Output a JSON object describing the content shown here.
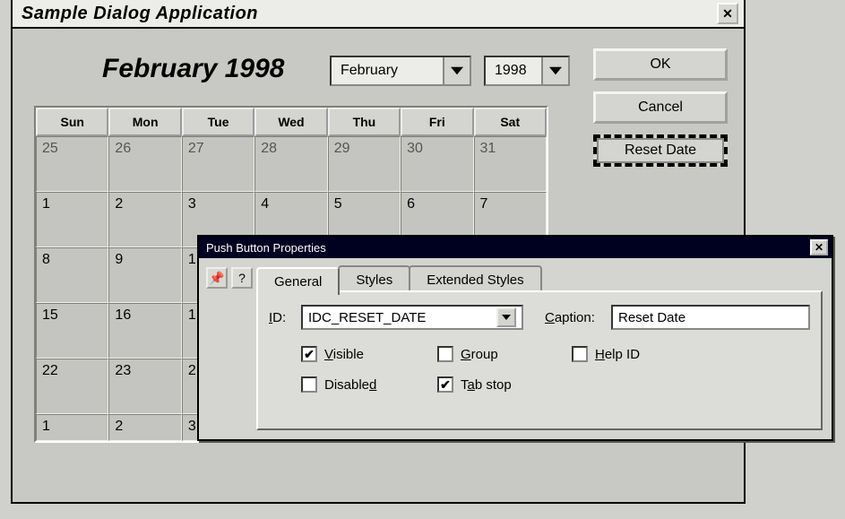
{
  "dialog": {
    "title": "Sample Dialog Application",
    "month_heading": "February 1998",
    "month_select": {
      "value": "February"
    },
    "year_select": {
      "value": "1998"
    },
    "buttons": {
      "ok": "OK",
      "cancel": "Cancel",
      "reset": "Reset Date"
    },
    "calendar": {
      "day_headers": [
        "Sun",
        "Mon",
        "Tue",
        "Wed",
        "Thu",
        "Fri",
        "Sat"
      ],
      "rows": [
        {
          "cells": [
            "25",
            "26",
            "27",
            "28",
            "29",
            "30",
            "31"
          ],
          "dim": true
        },
        {
          "cells": [
            "1",
            "2",
            "3",
            "4",
            "5",
            "6",
            "7"
          ]
        },
        {
          "cells": [
            "8",
            "9",
            "1",
            "",
            "",
            "",
            ""
          ]
        },
        {
          "cells": [
            "15",
            "16",
            "1",
            "",
            "",
            "",
            ""
          ]
        },
        {
          "cells": [
            "22",
            "23",
            "2",
            "",
            "",
            "",
            ""
          ]
        },
        {
          "cells": [
            "1",
            "2",
            "3",
            "",
            "",
            "",
            ""
          ],
          "short": true
        }
      ]
    }
  },
  "properties": {
    "title": "Push Button Properties",
    "tabs": [
      "General",
      "Styles",
      "Extended Styles"
    ],
    "active_tab": 0,
    "labels": {
      "id": "ID:",
      "caption": "Caption:",
      "visible": "Visible",
      "disabled": "Disabled",
      "group": "Group",
      "tabstop": "Tab stop",
      "helpid": "Help ID"
    },
    "id_value": "IDC_RESET_DATE",
    "caption_value": "Reset Date",
    "checks": {
      "visible": true,
      "disabled": false,
      "group": false,
      "tabstop": true,
      "helpid": false
    }
  }
}
